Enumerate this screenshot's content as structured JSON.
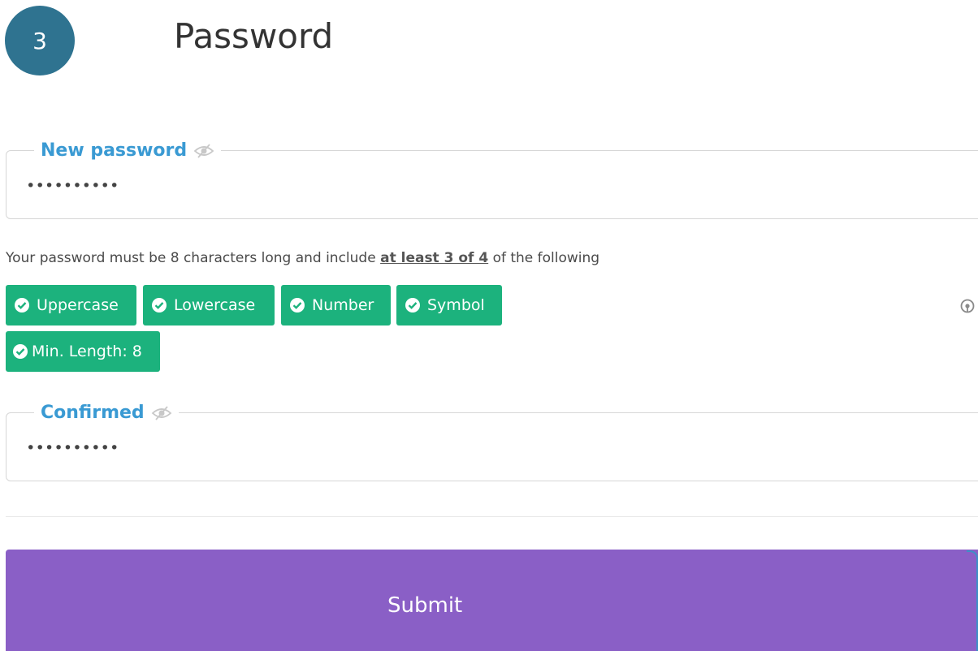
{
  "header": {
    "step_number": "3",
    "title": "Password"
  },
  "new_password": {
    "label": "New password",
    "value": "••••••••••",
    "visibility_icon": "eye-off-icon"
  },
  "hint": {
    "prefix": "Your password must be 8 characters long and include ",
    "emphasis": "at least 3 of 4",
    "suffix": " of the following"
  },
  "requirements": [
    {
      "label": "Uppercase",
      "icon": "check-circle-icon",
      "met": true
    },
    {
      "label": "Lowercase",
      "icon": "check-circle-icon",
      "met": true
    },
    {
      "label": "Number",
      "icon": "check-circle-icon",
      "met": true
    },
    {
      "label": "Symbol",
      "icon": "check-circle-icon",
      "met": true
    },
    {
      "label": "Min. Length: 8",
      "icon": "check-circle-icon",
      "met": true
    }
  ],
  "confirm_password": {
    "label": "Confirmed",
    "value": "••••••••••",
    "visibility_icon": "eye-off-icon"
  },
  "submit": {
    "label": "Submit"
  },
  "colors": {
    "step_badge": "#2f7390",
    "field_label": "#3a9ad3",
    "requirement_met": "#1cb27d",
    "submit_button": "#8a5fc6"
  }
}
